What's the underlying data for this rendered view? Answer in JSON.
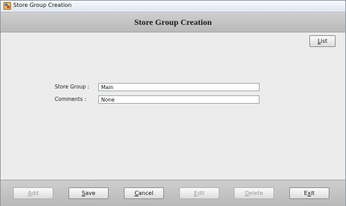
{
  "window": {
    "title": "Store Group Creation"
  },
  "header": {
    "title": "Store Group Creation"
  },
  "toolbar": {
    "list_pre": "",
    "list_u": "L",
    "list_post": "ist"
  },
  "form": {
    "store_group_label": "Store Group :",
    "store_group_value": "Main",
    "comments_label": "Comments :",
    "comments_value": "None"
  },
  "footer": {
    "add_pre": "",
    "add_u": "A",
    "add_post": "dd",
    "save_pre": "",
    "save_u": "S",
    "save_post": "ave",
    "cancel_pre": "",
    "cancel_u": "C",
    "cancel_post": "ancel",
    "edit_pre": "",
    "edit_u": "E",
    "edit_post": "dit",
    "delete_pre": "",
    "delete_u": "D",
    "delete_post": "elete",
    "exit_pre": "E",
    "exit_u": "x",
    "exit_post": "it"
  },
  "colors": {
    "header_bg": "#c4c4c4",
    "body_bg": "#ececec",
    "titlebar_bg": "#e6ecf4"
  },
  "icons": {
    "app_icon": "app-icon"
  }
}
